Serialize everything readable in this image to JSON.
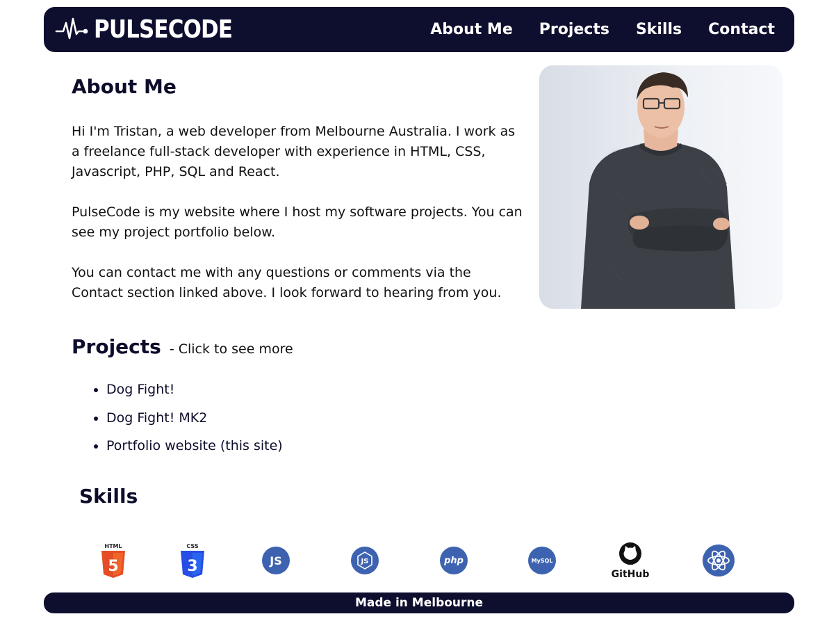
{
  "brand": {
    "name": "PULSECODE"
  },
  "nav": {
    "items": [
      "About Me",
      "Projects",
      "Skills",
      "Contact"
    ]
  },
  "about": {
    "title": "About Me",
    "paragraphs": [
      "Hi I'm Tristan, a web developer from Melbourne Australia. I work as a freelance full-stack developer with experience in HTML, CSS, Javascript, PHP, SQL and React.",
      "PulseCode is my website where I host my software projects. You can see my project portfolio below.",
      "You can contact me with any questions or comments via the Contact section linked above. I look forward to hearing from you."
    ]
  },
  "projects": {
    "title": "Projects",
    "subtitle": "- Click to see more",
    "items": [
      "Dog Fight!",
      "Dog Fight! MK2",
      "Portfolio website (this site)"
    ]
  },
  "skills": {
    "title": "Skills",
    "icons": [
      {
        "name": "html5-icon",
        "label": "HTML",
        "text": "5",
        "color": "#e44d26"
      },
      {
        "name": "css3-icon",
        "label": "CSS",
        "text": "3",
        "color": "#264de4"
      },
      {
        "name": "javascript-icon",
        "text": "JS",
        "color": "#3d63b0"
      },
      {
        "name": "nodejs-icon",
        "text": "JS",
        "color": "#3d63b0"
      },
      {
        "name": "php-icon",
        "text": "php",
        "color": "#3d63b0"
      },
      {
        "name": "mysql-icon",
        "text": "MySQL",
        "color": "#3d63b0"
      },
      {
        "name": "github-icon",
        "text": "GitHub",
        "color": "#111111"
      },
      {
        "name": "react-icon",
        "color": "#3d63b0"
      }
    ]
  },
  "footer": {
    "text": "Made in Melbourne"
  },
  "colors": {
    "navy": "#0e0e2e",
    "text": "#0d0d2b",
    "icon_blue": "#3d63b0"
  }
}
